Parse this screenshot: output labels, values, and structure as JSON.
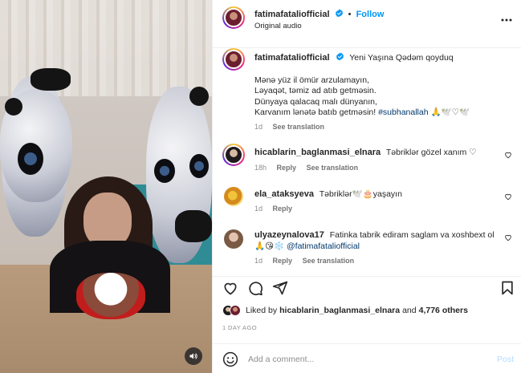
{
  "header": {
    "username": "fatimafataliofficial",
    "separator": "•",
    "follow_label": "Follow",
    "audio_label": "Original audio",
    "more_label": "•••"
  },
  "caption": {
    "username": "fatimafataliofficial",
    "title": "Yeni Yaşına Qədəm qoyduq",
    "lines": [
      "Mənə yüz il ömür arzulamayın,",
      "Ləyaqət, təmiz ad atıb getməsin.",
      "Dünyaya qalacaq malı dünyanın,",
      "Karvanım lənətə batıb getməsin!"
    ],
    "hashtag": "#subhanallah",
    "emojis": "🙏🕊️♡🕊️",
    "age": "1d",
    "see_translation": "See translation"
  },
  "comments": [
    {
      "username": "hicablarin_baglanmasi_elnara",
      "text": "Təbriklər gözel xanım ♡",
      "age": "18h",
      "reply": "Reply",
      "see_translation": "See translation"
    },
    {
      "username": "ela_ataksyeva",
      "text": "Təbriklər🕊️🎂yaşayın",
      "age": "1d",
      "reply": "Reply"
    },
    {
      "username": "ulyazeynalova17",
      "text": "Fatinka tabrik ediram saglam va xoshbext ol",
      "text2": "🙏😘❄️",
      "mention": "@fatimafataliofficial",
      "age": "1d",
      "reply": "Reply",
      "see_translation": "See translation"
    }
  ],
  "likes": {
    "prefix": "Liked by",
    "user": "hicablarin_baglanmasi_elnara",
    "and": "and",
    "others": "4,776 others"
  },
  "timestamp": "1 DAY AGO",
  "composer": {
    "placeholder": "Add a comment...",
    "post_label": "Post"
  },
  "colors": {
    "accent": "#0095f6",
    "post_disabled": "#b3dbff",
    "muted": "#8e8e8e"
  },
  "icons": [
    "volume-muted-icon",
    "more-options-icon",
    "verified-icon",
    "heart-icon",
    "comment-icon",
    "share-icon",
    "bookmark-icon",
    "emoji-icon"
  ]
}
